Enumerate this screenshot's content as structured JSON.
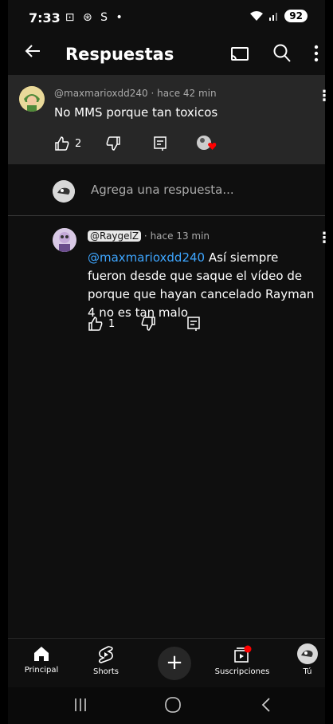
{
  "status": {
    "time": "7:33",
    "icons": "⊡ ⊛ S •",
    "battery": "92"
  },
  "appbar": {
    "title": "Respuestas",
    "back_icon": "arrow-left",
    "cast_icon": "cast",
    "search_icon": "search",
    "more_icon": "more-vert"
  },
  "parent_comment": {
    "author": "@maxmarioxdd240",
    "time": "hace 42 min",
    "text": "No MMS porque tan toxicos",
    "likes": "2"
  },
  "add_reply": {
    "placeholder": "Agrega una respuesta..."
  },
  "reply": {
    "author": "@RaygelZ",
    "time": "hace 13 min",
    "mention": "@maxmarioxdd240",
    "text": "Así siempre fueron desde que saque el vídeo de porque que hayan cancelado Rayman 4 no es tan malo",
    "likes": "1"
  },
  "nav": {
    "home": "Principal",
    "shorts": "Shorts",
    "create": "+",
    "subs": "Suscripciones",
    "you": "Tú"
  },
  "colors": {
    "bg": "#0f0f0f",
    "card": "#272727",
    "link": "#3ea6ff",
    "red": "#ff0000"
  }
}
